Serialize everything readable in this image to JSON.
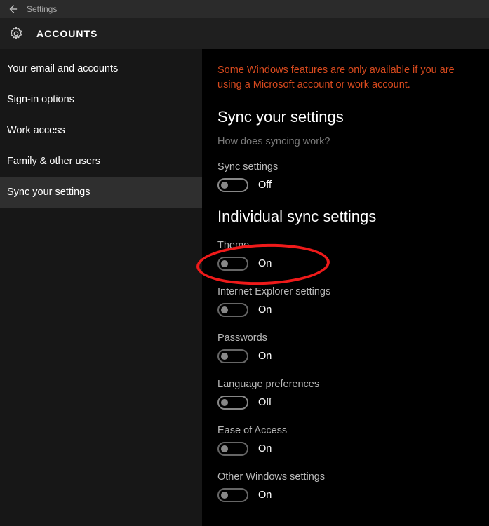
{
  "titlebar": {
    "title": "Settings"
  },
  "header": {
    "title": "ACCOUNTS"
  },
  "sidebar": {
    "items": [
      {
        "label": "Your email and accounts",
        "active": false
      },
      {
        "label": "Sign-in options",
        "active": false
      },
      {
        "label": "Work access",
        "active": false
      },
      {
        "label": "Family & other users",
        "active": false
      },
      {
        "label": "Sync your settings",
        "active": true
      }
    ]
  },
  "content": {
    "warning": "Some Windows features are only available if you are using a Microsoft account or work account.",
    "section_title": "Sync your settings",
    "help_link": "How does syncing work?",
    "sync_settings": {
      "label": "Sync settings",
      "state": "Off",
      "on": false
    },
    "individual_title": "Individual sync settings",
    "individual": [
      {
        "label": "Theme",
        "state": "On",
        "on": true
      },
      {
        "label": "Internet Explorer settings",
        "state": "On",
        "on": true
      },
      {
        "label": "Passwords",
        "state": "On",
        "on": true
      },
      {
        "label": "Language preferences",
        "state": "Off",
        "on": false
      },
      {
        "label": "Ease of Access",
        "state": "On",
        "on": true
      },
      {
        "label": "Other Windows settings",
        "state": "On",
        "on": true
      }
    ]
  }
}
